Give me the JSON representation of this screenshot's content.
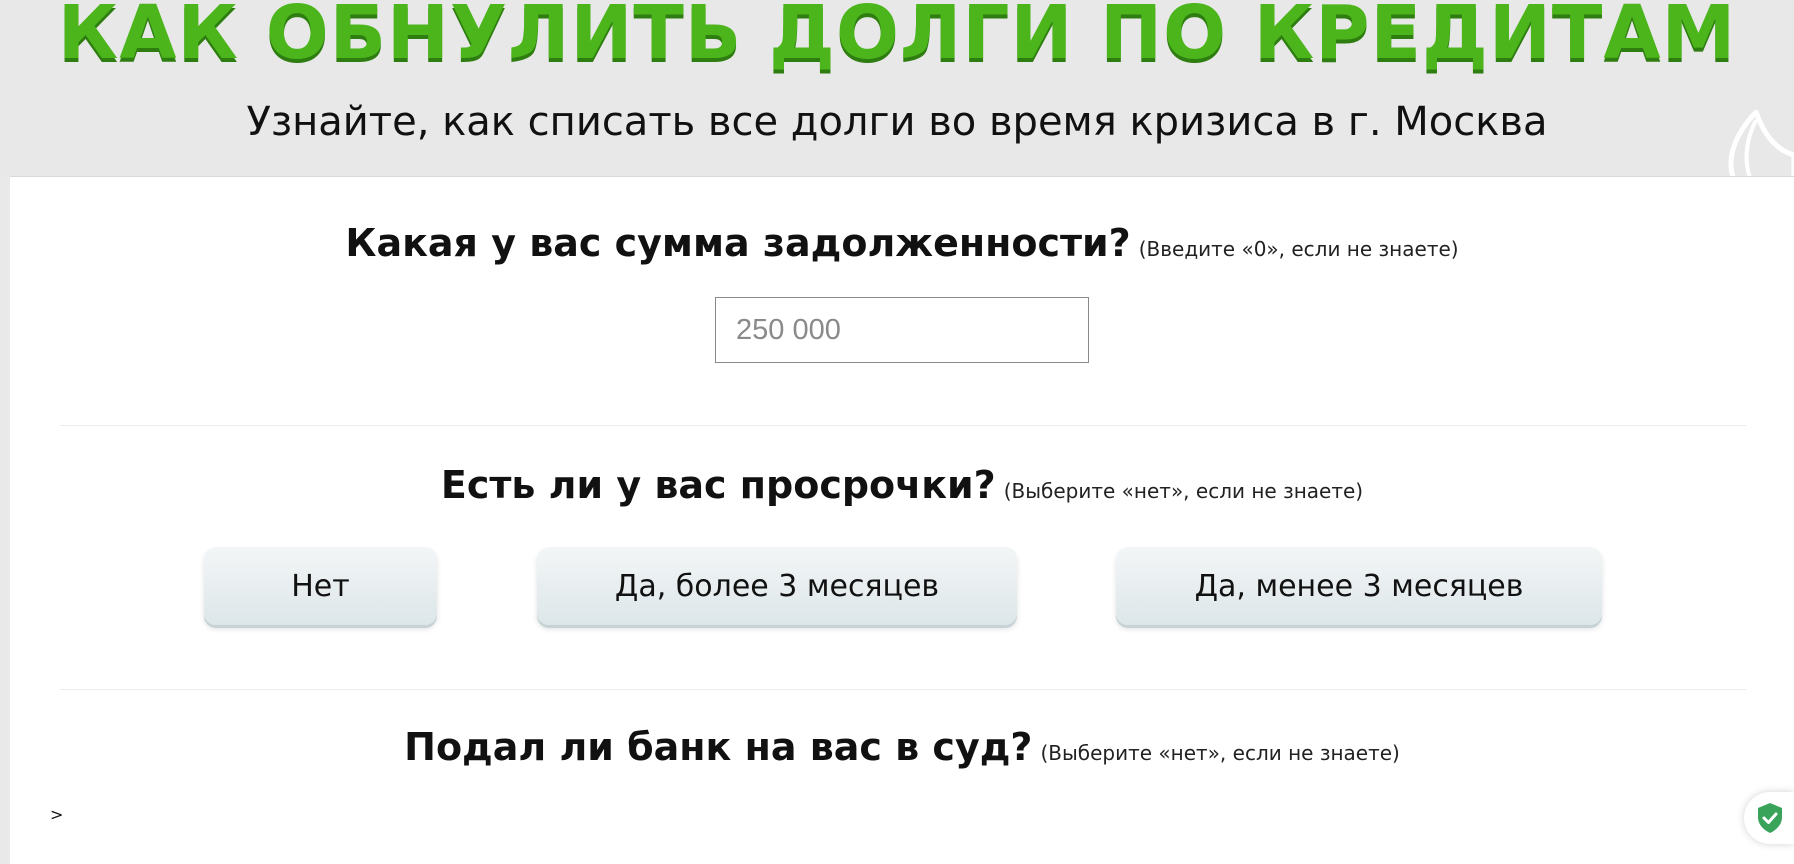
{
  "header": {
    "title": "КАК ОБНУЛИТЬ ДОЛГИ ПО КРЕДИТАМ",
    "subtitle": "Узнайте, как списать все долги во время кризиса в г. Москва"
  },
  "questions": [
    {
      "title": "Какая у вас сумма задолженности?",
      "hint": "(Введите «0», если не знаете)",
      "input": {
        "value": "",
        "placeholder": "250 000"
      }
    },
    {
      "title": "Есть ли у вас просрочки?",
      "hint": "(Выберите «нет», если не знаете)",
      "options": [
        "Нет",
        "Да, более 3 месяцев",
        "Да, менее 3 месяцев"
      ]
    },
    {
      "title": "Подал ли банк на вас в суд?",
      "hint": "(Выберите «нет», если не знаете)"
    }
  ],
  "misc": {
    "chevron": ">"
  },
  "colors": {
    "title_green": "#4cb51c",
    "title_shadow": "#2e7d10",
    "badge_green": "#3aa35a"
  },
  "icons": {
    "leaf": "leaf-icon",
    "shield": "shield-check-icon"
  }
}
